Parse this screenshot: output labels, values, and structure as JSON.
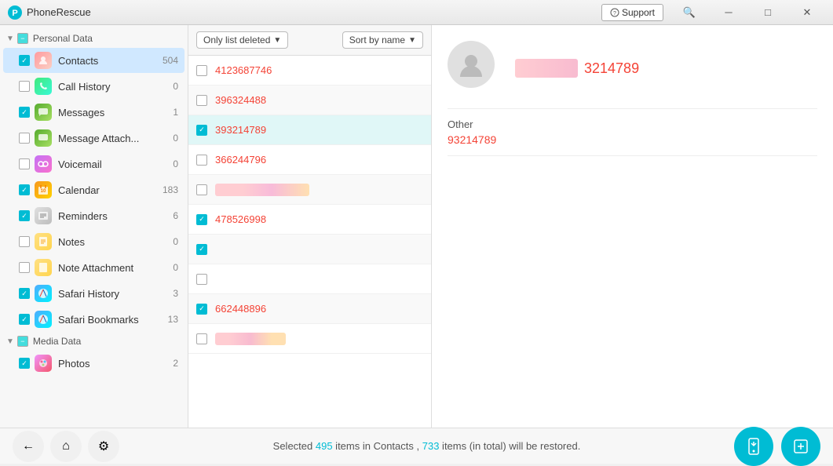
{
  "titleBar": {
    "appName": "PhoneRescue",
    "supportLabel": "Support"
  },
  "sidebar": {
    "sections": [
      {
        "id": "personal-data",
        "label": "Personal Data",
        "checked": "partial",
        "items": [
          {
            "id": "contacts",
            "label": "Contacts",
            "count": "504",
            "icon": "contacts",
            "checked": true,
            "active": true
          },
          {
            "id": "call-history",
            "label": "Call History",
            "count": "0",
            "icon": "call",
            "checked": false
          },
          {
            "id": "messages",
            "label": "Messages",
            "count": "1",
            "icon": "messages",
            "checked": true
          },
          {
            "id": "message-attach",
            "label": "Message Attach...",
            "count": "0",
            "icon": "msgattach",
            "checked": false
          },
          {
            "id": "voicemail",
            "label": "Voicemail",
            "count": "0",
            "icon": "voicemail",
            "checked": false
          },
          {
            "id": "calendar",
            "label": "Calendar",
            "count": "183",
            "icon": "calendar",
            "checked": true
          },
          {
            "id": "reminders",
            "label": "Reminders",
            "count": "6",
            "icon": "reminders",
            "checked": true
          },
          {
            "id": "notes",
            "label": "Notes",
            "count": "0",
            "icon": "notes",
            "checked": false
          },
          {
            "id": "note-attachment",
            "label": "Note Attachment",
            "count": "0",
            "icon": "noteattach",
            "checked": false
          },
          {
            "id": "safari-history",
            "label": "Safari History",
            "count": "3",
            "icon": "safari",
            "checked": true
          },
          {
            "id": "safari-bookmarks",
            "label": "Safari Bookmarks",
            "count": "13",
            "icon": "safaribk",
            "checked": true
          }
        ]
      },
      {
        "id": "media-data",
        "label": "Media Data",
        "checked": "partial",
        "items": [
          {
            "id": "photos",
            "label": "Photos",
            "count": "2",
            "icon": "photos",
            "checked": true
          }
        ]
      }
    ]
  },
  "listPanel": {
    "filterLabel": "Only list deleted",
    "sortLabel": "Sort by name",
    "rows": [
      {
        "id": "r1",
        "text": "4123687746",
        "checked": false,
        "deleted": true,
        "blurred": false,
        "selected": false,
        "alt": false
      },
      {
        "id": "r2",
        "text": "396324488",
        "checked": false,
        "deleted": true,
        "blurred": false,
        "selected": false,
        "alt": true
      },
      {
        "id": "r3",
        "text": "393214789",
        "checked": true,
        "deleted": true,
        "blurred": false,
        "selected": true,
        "alt": false
      },
      {
        "id": "r4",
        "text": "366244796",
        "checked": false,
        "deleted": true,
        "blurred": false,
        "selected": false,
        "alt": false
      },
      {
        "id": "r5",
        "text": "",
        "checked": false,
        "deleted": false,
        "blurred": true,
        "selected": false,
        "alt": true
      },
      {
        "id": "r6",
        "text": "478526998",
        "checked": true,
        "deleted": true,
        "blurred": false,
        "selected": false,
        "alt": false
      },
      {
        "id": "r7",
        "text": "",
        "checked": true,
        "deleted": false,
        "blurred": false,
        "selected": false,
        "alt": true,
        "empty": true
      },
      {
        "id": "r8",
        "text": "",
        "checked": false,
        "deleted": false,
        "blurred": false,
        "selected": false,
        "alt": false,
        "empty": true
      },
      {
        "id": "r9",
        "text": "662448896",
        "checked": true,
        "deleted": true,
        "blurred": false,
        "selected": false,
        "alt": true
      },
      {
        "id": "r10",
        "text": "",
        "checked": false,
        "deleted": false,
        "blurred": true,
        "selected": false,
        "alt": false
      }
    ]
  },
  "detailPanel": {
    "nameBlurred": true,
    "nameVisible": "3214789",
    "sectionTitle": "Other",
    "sectionValue": "93214789"
  },
  "bottomBar": {
    "selectedCount": "495",
    "selectedType": "Contacts",
    "totalCount": "733",
    "statusText": "Selected {495} items in Contacts , {733} items (in total) will be restored.",
    "backLabel": "←",
    "homeLabel": "⌂",
    "settingsLabel": "⚙",
    "restoreLabel": "📱",
    "exportLabel": "📤"
  }
}
